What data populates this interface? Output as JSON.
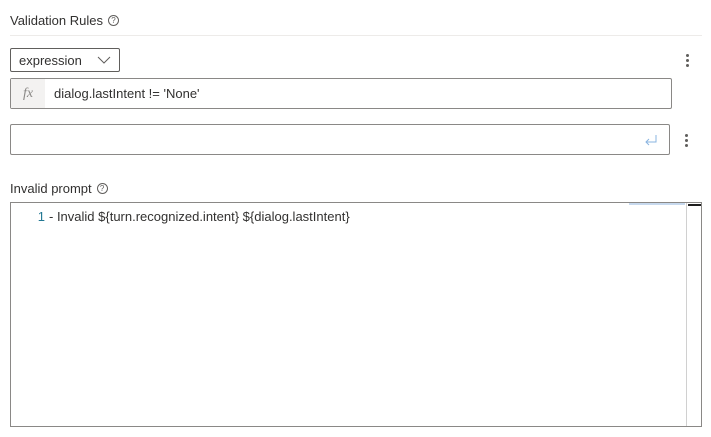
{
  "validation": {
    "title": "Validation Rules",
    "dropdown_value": "expression",
    "fx_symbol": "fx",
    "expression": "dialog.lastIntent != 'None'",
    "new_rule_value": ""
  },
  "invalid_prompt": {
    "label": "Invalid prompt",
    "line_number": "1",
    "code": "- Invalid ${turn.recognized.intent} ${dialog.lastIntent}"
  },
  "help_glyph": "?",
  "colors": {
    "border": "#8a8886",
    "accent": "#0078d4",
    "line_number": "#237893"
  },
  "icons": [
    "help-icon",
    "chevron-down-icon",
    "more-vertical-icon",
    "enter-icon"
  ]
}
